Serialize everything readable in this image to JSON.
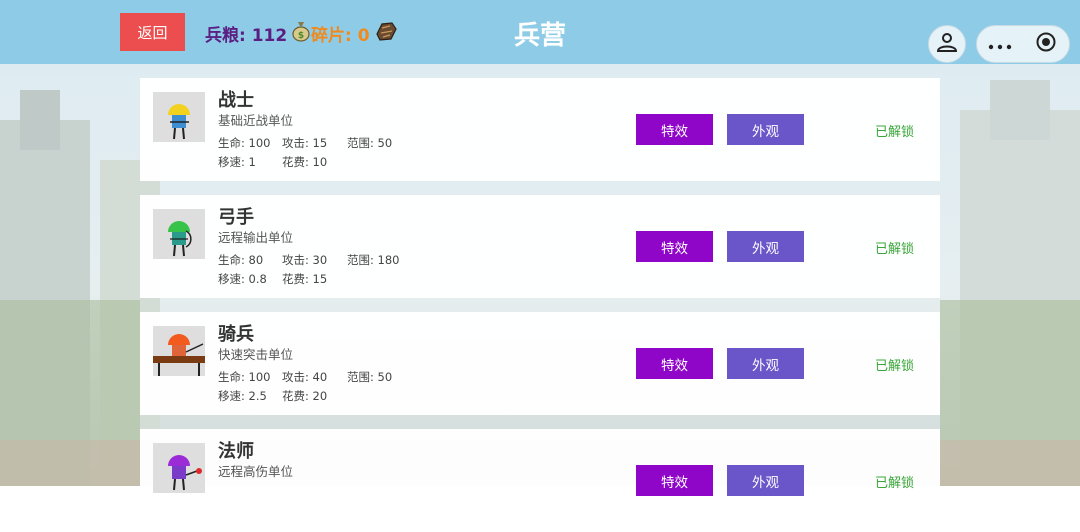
{
  "header": {
    "back_label": "返回",
    "title": "兵营",
    "food_label": "兵粮: 112",
    "shard_label": "碎片: 0"
  },
  "icons": {
    "food": "money-bag-icon",
    "shard": "shard-rock-icon",
    "avatar": "avatar-icon",
    "more": "more-dots-icon",
    "close": "target-circle-icon"
  },
  "colors": {
    "header_bg": "#8ecbe7",
    "back_button": "#ec4d4f",
    "effects_button": "#9006c9",
    "appearance_button": "#6a56c8",
    "unlocked_text": "#3aa63a",
    "food_text": "#5b1f82",
    "shard_text": "#f08a1d"
  },
  "units": [
    {
      "name": "战士",
      "desc": "基础近战单位",
      "hp": "生命: 100",
      "atk": "攻击: 15",
      "range": "范围: 50",
      "speed": "移速: 1",
      "cost": "花费: 10",
      "effects_label": "特效",
      "appearance_label": "外观",
      "status": "已解锁",
      "helmet_color": "#f2d21e",
      "body_color": "#3d8fd1"
    },
    {
      "name": "弓手",
      "desc": "远程输出单位",
      "hp": "生命: 80",
      "atk": "攻击: 30",
      "range": "范围: 180",
      "speed": "移速: 0.8",
      "cost": "花费: 15",
      "effects_label": "特效",
      "appearance_label": "外观",
      "status": "已解锁",
      "helmet_color": "#37c24a",
      "body_color": "#2a9a8a"
    },
    {
      "name": "骑兵",
      "desc": "快速突击单位",
      "hp": "生命: 100",
      "atk": "攻击: 40",
      "range": "范围: 50",
      "speed": "移速: 2.5",
      "cost": "花费: 20",
      "effects_label": "特效",
      "appearance_label": "外观",
      "status": "已解锁",
      "helmet_color": "#f25a1e",
      "body_color": "#e0643a"
    },
    {
      "name": "法师",
      "desc": "远程高伤单位",
      "effects_label": "特效",
      "appearance_label": "外观",
      "status": "已解锁",
      "helmet_color": "#9a2bd6",
      "body_color": "#7a3cc8"
    }
  ]
}
